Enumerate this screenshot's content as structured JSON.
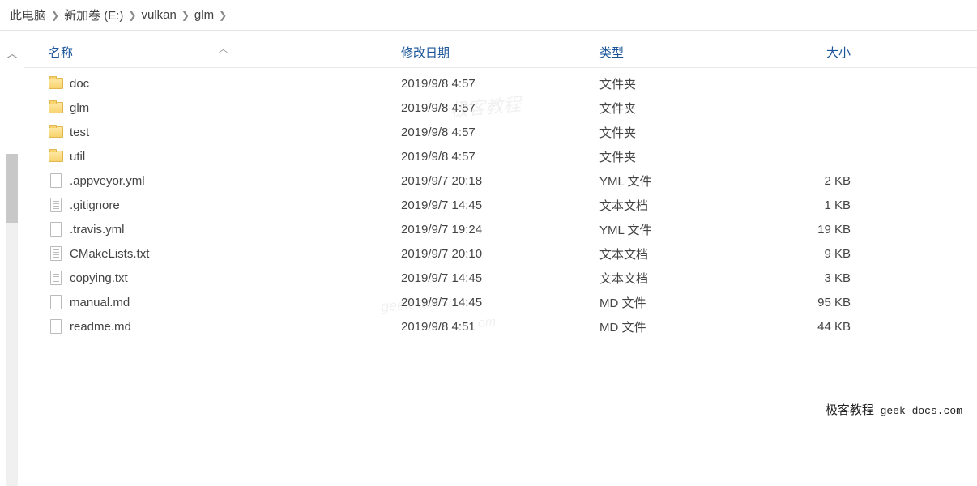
{
  "breadcrumb": [
    {
      "label": "此电脑"
    },
    {
      "label": "新加卷 (E:)"
    },
    {
      "label": "vulkan"
    },
    {
      "label": "glm"
    }
  ],
  "columns": {
    "name": "名称",
    "date": "修改日期",
    "type": "类型",
    "size": "大小"
  },
  "items": [
    {
      "name": "doc",
      "date": "2019/9/8 4:57",
      "type": "文件夹",
      "size": "",
      "icon": "folder"
    },
    {
      "name": "glm",
      "date": "2019/9/8 4:57",
      "type": "文件夹",
      "size": "",
      "icon": "folder"
    },
    {
      "name": "test",
      "date": "2019/9/8 4:57",
      "type": "文件夹",
      "size": "",
      "icon": "folder"
    },
    {
      "name": "util",
      "date": "2019/9/8 4:57",
      "type": "文件夹",
      "size": "",
      "icon": "folder"
    },
    {
      "name": ".appveyor.yml",
      "date": "2019/9/7 20:18",
      "type": "YML 文件",
      "size": "2 KB",
      "icon": "file"
    },
    {
      "name": ".gitignore",
      "date": "2019/9/7 14:45",
      "type": "文本文档",
      "size": "1 KB",
      "icon": "text"
    },
    {
      "name": ".travis.yml",
      "date": "2019/9/7 19:24",
      "type": "YML 文件",
      "size": "19 KB",
      "icon": "file"
    },
    {
      "name": "CMakeLists.txt",
      "date": "2019/9/7 20:10",
      "type": "文本文档",
      "size": "9 KB",
      "icon": "text"
    },
    {
      "name": "copying.txt",
      "date": "2019/9/7 14:45",
      "type": "文本文档",
      "size": "3 KB",
      "icon": "text"
    },
    {
      "name": "manual.md",
      "date": "2019/9/7 14:45",
      "type": "MD 文件",
      "size": "95 KB",
      "icon": "file"
    },
    {
      "name": "readme.md",
      "date": "2019/9/8 4:51",
      "type": "MD 文件",
      "size": "44 KB",
      "icon": "file"
    }
  ],
  "watermarks": {
    "wm1": "极客教程",
    "wm2": "geek-docs",
    "wm3": "om"
  },
  "footer": {
    "brand": "极客教程",
    "domain": "geek-docs.com"
  }
}
